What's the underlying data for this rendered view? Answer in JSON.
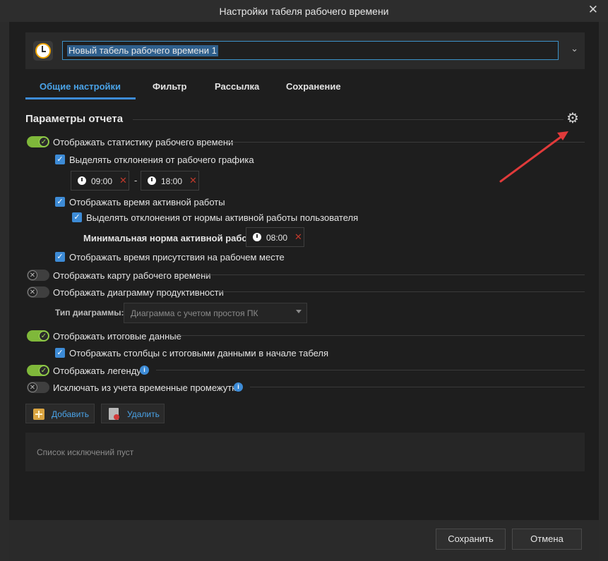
{
  "window": {
    "title": "Настройки табеля рабочего времени",
    "close_glyph": "✕"
  },
  "report_name": "Новый табель рабочего времени 1",
  "tabs": [
    {
      "label": "Общие настройки",
      "active": true
    },
    {
      "label": "Фильтр"
    },
    {
      "label": "Рассылка"
    },
    {
      "label": "Сохранение"
    }
  ],
  "section": {
    "title": "Параметры отчета"
  },
  "options": {
    "show_stats": {
      "label": "Отображать статистику рабочего времени",
      "on": true
    },
    "highlight_deviations": {
      "label": "Выделять отклонения от рабочего графика",
      "checked": true
    },
    "time_from": "09:00",
    "time_sep": "-",
    "time_to": "18:00",
    "show_active": {
      "label": "Отображать время активной работы",
      "checked": true
    },
    "highlight_active_dev": {
      "label": "Выделять отклонения от нормы активной работы пользователя",
      "checked": true
    },
    "min_active_label": "Минимальная норма активной работы:",
    "min_active_value": "08:00",
    "show_presence": {
      "label": "Отображать время присутствия на рабочем месте",
      "checked": true
    },
    "show_map": {
      "label": "Отображать карту рабочего времени",
      "on": false
    },
    "show_diagram": {
      "label": "Отображать диаграмму продуктивности",
      "on": false
    },
    "diagram_type_label": "Тип диаграммы:",
    "diagram_type_value": "Диаграмма с учетом простоя ПК",
    "show_totals": {
      "label": "Отображать итоговые данные",
      "on": true
    },
    "totals_columns_first": {
      "label": "Отображать столбцы с итоговыми данными в начале табеля",
      "checked": true
    },
    "show_legend": {
      "label": "Отображать легенду",
      "on": true
    },
    "exclude_intervals": {
      "label": "Исключать из учета временные промежутки",
      "on": false
    }
  },
  "actions": {
    "add": "Добавить",
    "delete": "Удалить"
  },
  "exclusions_empty": "Список исключений пуст",
  "footer": {
    "save": "Сохранить",
    "cancel": "Отмена"
  },
  "colors": {
    "accent": "#3d8bd6",
    "toggle_on": "#7fb83a",
    "annotation_arrow": "#e03a3a"
  }
}
